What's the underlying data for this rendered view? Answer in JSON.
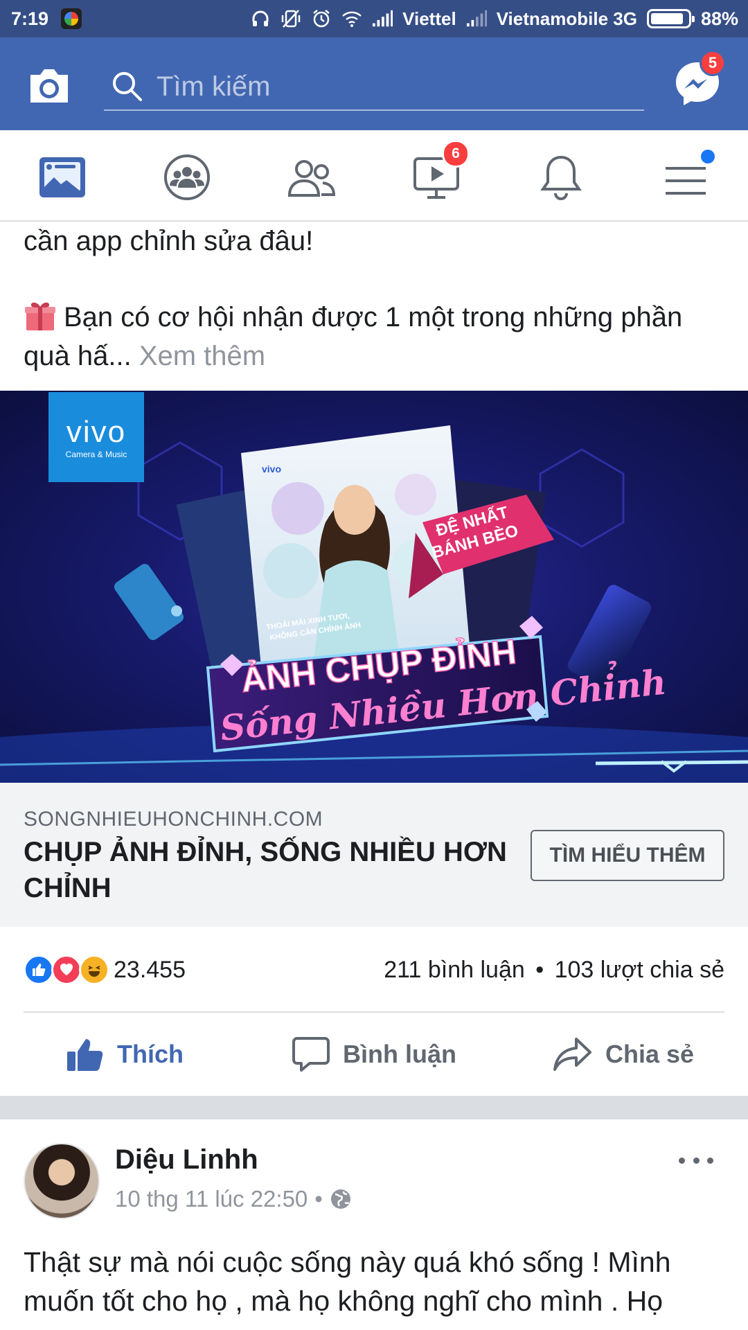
{
  "status_bar": {
    "time": "7:19",
    "carrier1": "Viettel",
    "carrier2": "Vietnamobile 3G",
    "battery": "88%",
    "battery_level": 0.88
  },
  "top_bar": {
    "search_placeholder": "Tìm kiếm",
    "messenger_badge": "5",
    "accent": "#4267b2"
  },
  "nav_tabs": {
    "items": [
      {
        "name": "news-feed",
        "active": true
      },
      {
        "name": "groups"
      },
      {
        "name": "friends"
      },
      {
        "name": "watch",
        "badge": "6"
      },
      {
        "name": "notifications"
      },
      {
        "name": "menu",
        "dot": true
      }
    ]
  },
  "post": {
    "text_line1": "cần app chỉnh sửa đâu!",
    "text_line2": "Bạn có cơ hội nhận được 1 một trong những phần quà hấ...",
    "see_more": "Xem thêm",
    "ad_image": {
      "brand": "vivo",
      "brand_sub": "Camera & Music",
      "badge_line1": "ĐỆ NHẤT",
      "badge_line2": "BÁNH BÈO",
      "caption1": "THOẢI MÁI XINH TƯƠI,",
      "caption2": "KHÔNG CẦN CHỈNH ẢNH",
      "headline": "ẢNH CHỤP ĐỈNH",
      "script_line": "Sống Nhiều Hơn Chỉnh"
    },
    "link": {
      "domain": "SONGNHIEUHONCHINH.COM",
      "title": "CHỤP ẢNH ĐỈNH, SỐNG NHIỀU HƠN CHỈNH",
      "button": "TÌM HIỂU THÊM"
    },
    "reactions": {
      "count": "23.455",
      "comments": "211 bình luận",
      "separator": "•",
      "shares": "103 lượt chia sẻ"
    },
    "actions": {
      "like": "Thích",
      "comment": "Bình luận",
      "share": "Chia sẻ"
    }
  },
  "next_post": {
    "author": "Diệu Linhh",
    "timestamp": "10 thg 11 lúc 22:50",
    "separator": "•",
    "text": "Thật sự mà nói cuộc sống này quá khó sống ! Mình muốn tốt cho họ , mà họ không nghĩ cho mình . Họ"
  }
}
